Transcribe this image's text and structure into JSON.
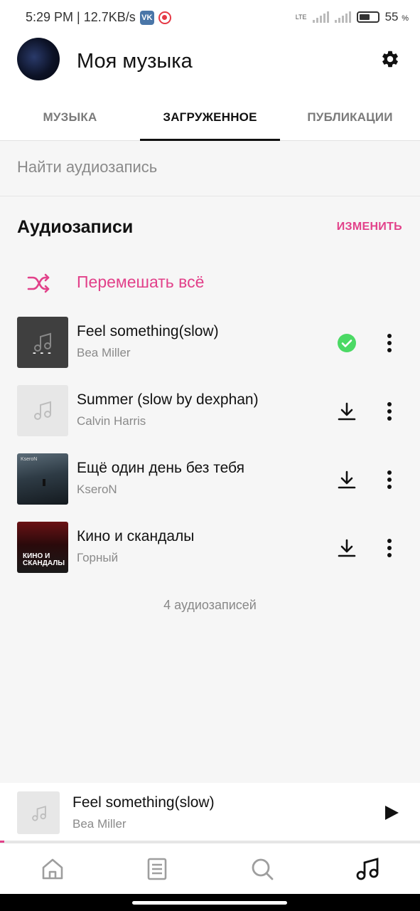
{
  "status_bar": {
    "time_speed": "5:29 PM | 12.7KB/s",
    "vk_badge": "VK",
    "network": "LTE",
    "battery_percent": "55",
    "battery_unit": "%"
  },
  "header": {
    "title": "Моя музыка",
    "settings_icon": "gear-icon"
  },
  "tabs": [
    {
      "label": "МУЗЫКА",
      "active": false
    },
    {
      "label": "ЗАГРУЖЕННОЕ",
      "active": true
    },
    {
      "label": "ПУБЛИКАЦИИ",
      "active": false
    }
  ],
  "search": {
    "placeholder": "Найти аудиозапись",
    "value": ""
  },
  "section": {
    "title": "Аудиозаписи",
    "edit_label": "ИЗМЕНИТЬ"
  },
  "shuffle": {
    "label": "Перемешать всё",
    "icon": "shuffle-icon"
  },
  "tracks": [
    {
      "title": "Feel something(slow)",
      "artist": "Bea Miller",
      "status": "downloaded",
      "status_icon": "check-circle-icon"
    },
    {
      "title": "Summer (slow by dexphan)",
      "artist": "Calvin Harris",
      "status": "not-downloaded",
      "status_icon": "download-icon"
    },
    {
      "title": "Ещё один день без тебя",
      "artist": "KseroN",
      "status": "not-downloaded",
      "status_icon": "download-icon",
      "cover_text": "KseroN"
    },
    {
      "title": "Кино и скандалы",
      "artist": "Горный",
      "status": "not-downloaded",
      "status_icon": "download-icon",
      "cover_text": "КИНО И СКАНДАЛЫ"
    }
  ],
  "tracks_count": "4 аудиозаписей",
  "player": {
    "title": "Feel something(slow)",
    "artist": "Bea Miller",
    "progress": 0.01,
    "play_icon": "play-icon"
  },
  "bottom_nav": [
    {
      "name": "home",
      "icon": "home-icon",
      "active": false
    },
    {
      "name": "news",
      "icon": "newsfeed-icon",
      "active": false
    },
    {
      "name": "search",
      "icon": "search-icon",
      "active": false
    },
    {
      "name": "music",
      "icon": "music-note-icon",
      "active": true
    }
  ],
  "colors": {
    "accent": "#e2418a",
    "downloaded_check": "#4bd964",
    "text_primary": "#111111",
    "text_secondary": "#8a8a8a"
  }
}
